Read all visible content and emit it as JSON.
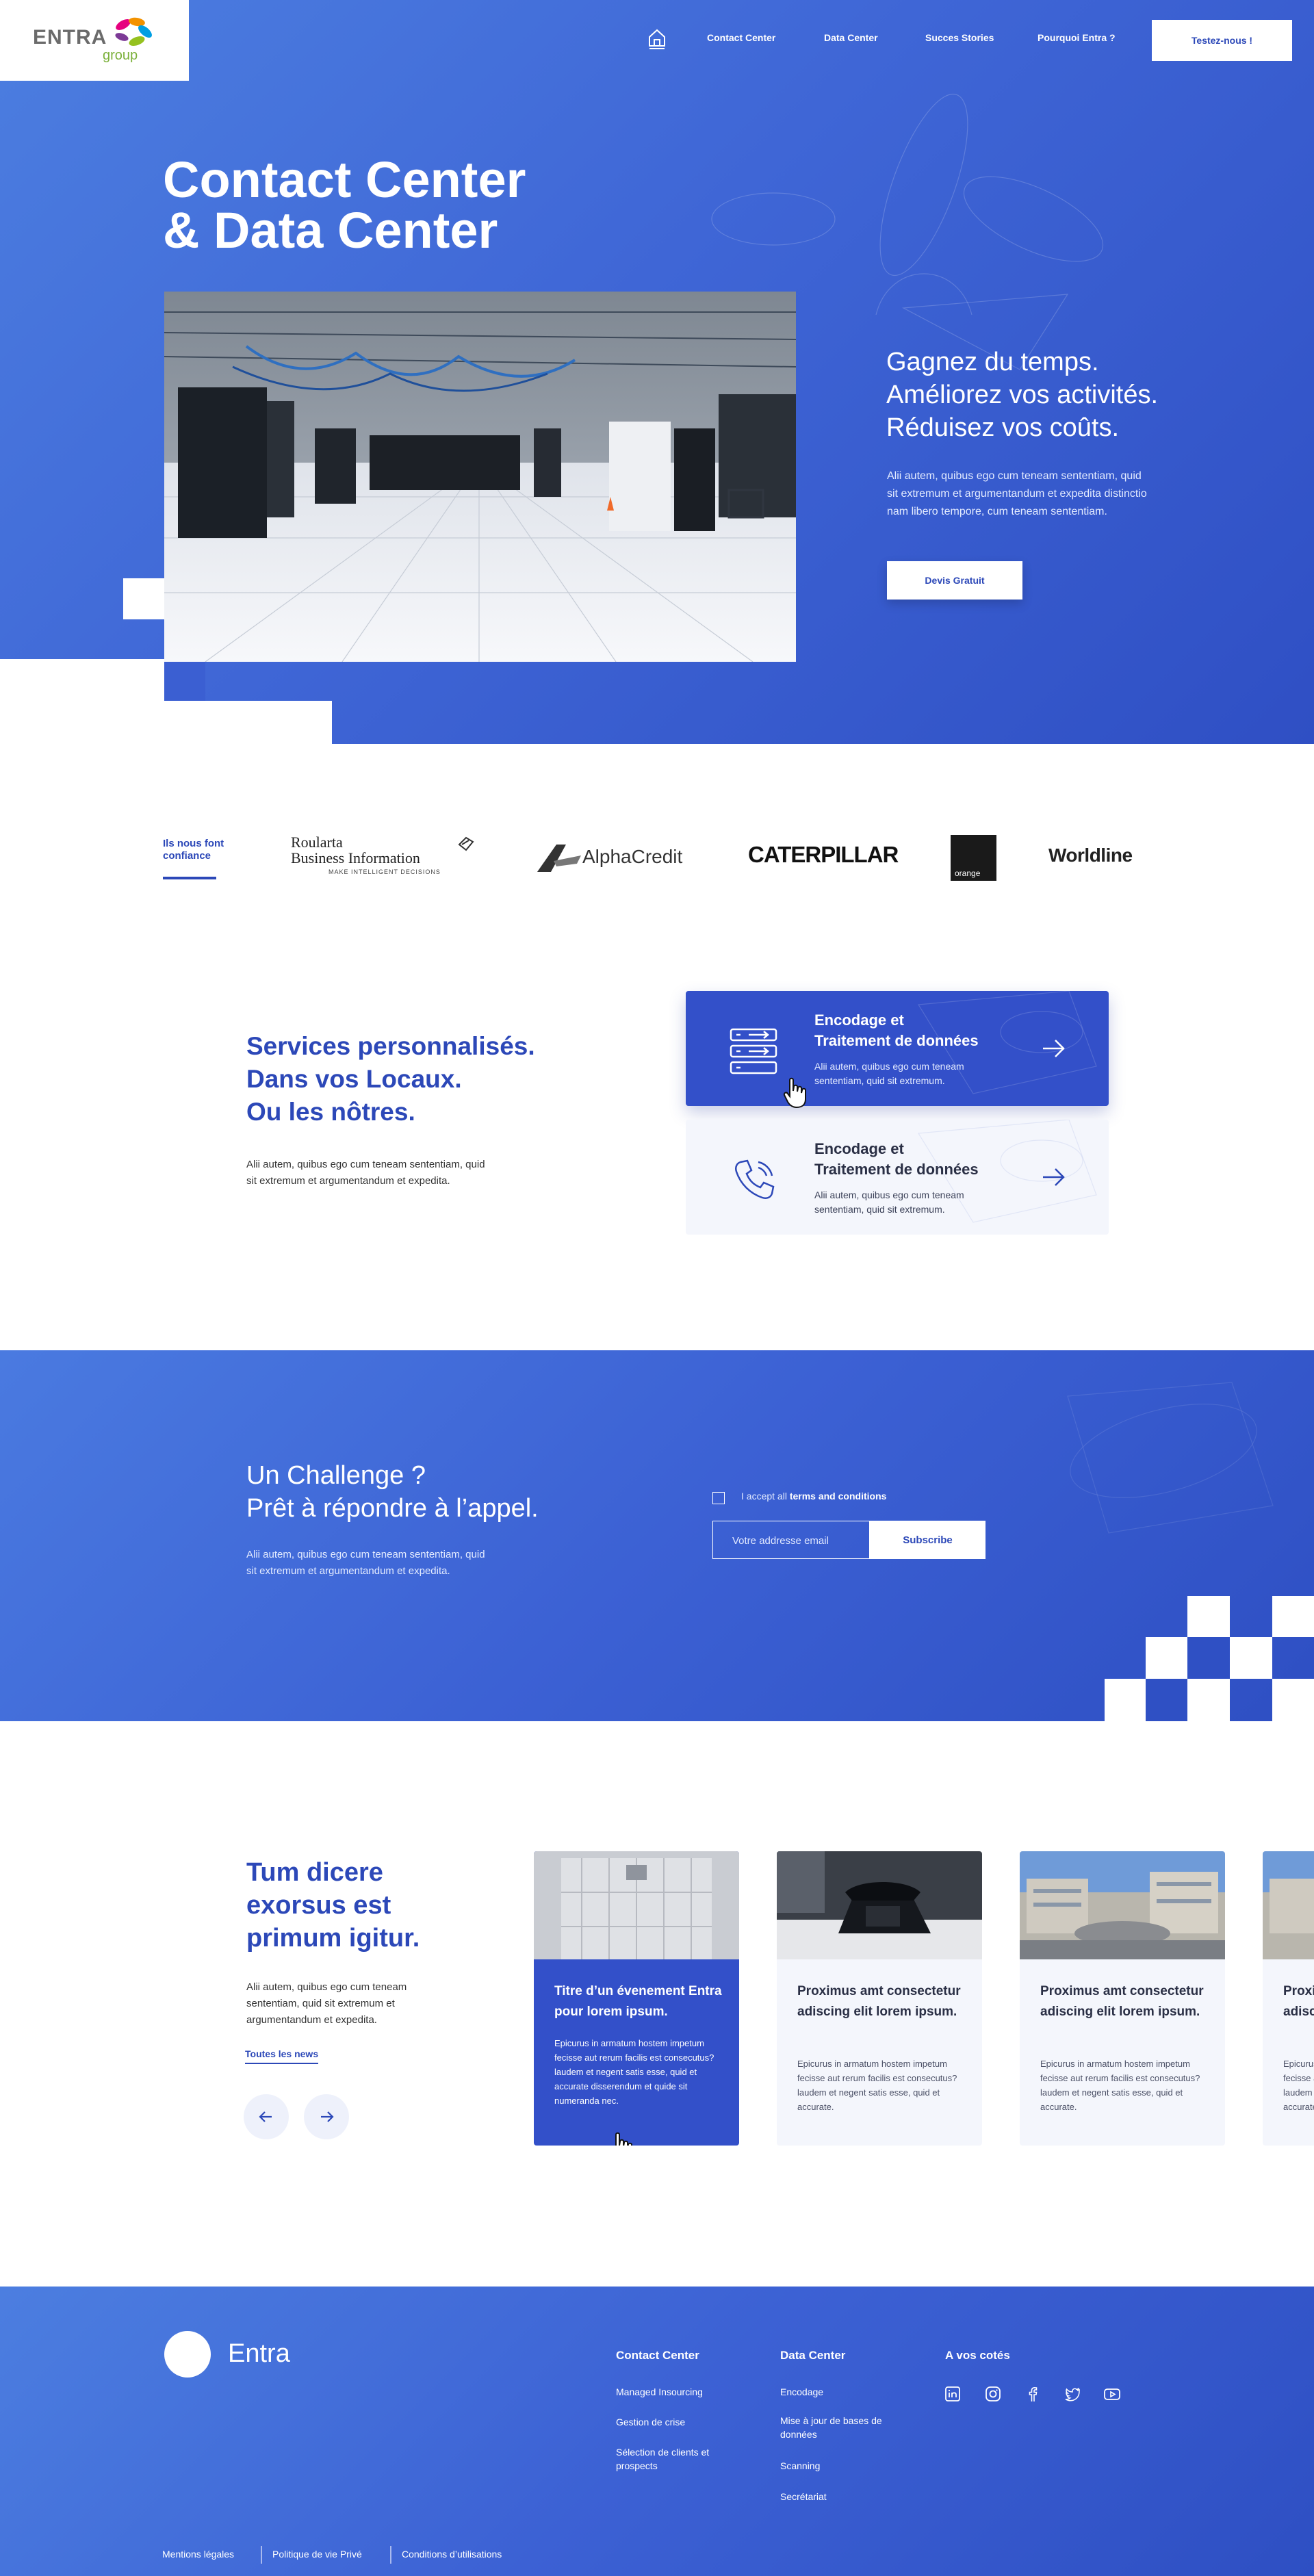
{
  "brand": {
    "name": "ENTRA",
    "sub": "group",
    "footer_name": "Entra"
  },
  "nav": {
    "items": [
      "Contact Center",
      "Data Center",
      "Succes Stories",
      "Pourquoi Entra ?"
    ],
    "cta": "Testez-nous !"
  },
  "hero": {
    "title_1": "Contact Center",
    "title_2": "& Data Center",
    "tagline_1": "Gagnez du temps.",
    "tagline_2": "Améliorez vos activités.",
    "tagline_3": "Réduisez vos coûts.",
    "text": "Alii autem, quibus ego cum teneam sententiam, quid sit extremum et argumentandum et expedita distinctio nam libero tempore, cum teneam sententiam.",
    "cta": "Devis Gratuit"
  },
  "clients": {
    "label_1": "Ils nous font",
    "label_2": "confiance",
    "logos": {
      "roularta_1": "Roularta",
      "roularta_2": "Business Information",
      "roularta_3": "MAKE INTELLIGENT DECISIONS",
      "alpha": "AlphaCredit",
      "cat": "CATERPILLAR",
      "orange": "orange",
      "worldline": "Worldline"
    }
  },
  "services": {
    "title_1": "Services personnalisés.",
    "title_2": "Dans vos Locaux.",
    "title_3": "Ou les nôtres.",
    "text": "Alii autem, quibus ego cum teneam sententiam, quid sit extremum et argumentandum et expedita.",
    "cards": [
      {
        "title_1": "Encodage et",
        "title_2": "Traitement de données",
        "text": "Alii autem, quibus ego cum teneam sententiam, quid sit extremum."
      },
      {
        "title_1": "Encodage et",
        "title_2": "Traitement de données",
        "text": "Alii autem, quibus ego cum teneam sententiam, quid sit extremum."
      }
    ]
  },
  "challenge": {
    "title_1": "Un Challenge ?",
    "title_2": "Prêt à répondre à l’appel.",
    "text": "Alii autem, quibus ego cum teneam sententiam, quid sit extremum et argumentandum et expedita.",
    "terms_prefix": "I accept all ",
    "terms_link": "terms and conditions",
    "email_placeholder": "Votre addresse email",
    "subscribe": "Subscribe"
  },
  "news": {
    "title_1": "Tum dicere",
    "title_2": "exorsus est",
    "title_3": "primum igitur.",
    "text": "Alii autem, quibus ego cum teneam sententiam, quid sit extremum et argumentandum et expedita.",
    "link": "Toutes les news",
    "cards": [
      {
        "title": "Titre d’un évenement Entra pour lorem ipsum.",
        "text": "Epicurus in armatum hostem impetum fecisse aut rerum facilis est consecutus? laudem et negent satis esse, quid et accurate disserendum et quide sit numeranda nec."
      },
      {
        "title": "Proximus amt consectetur adiscing elit lorem ipsum.",
        "text": "Epicurus in armatum hostem impetum fecisse aut rerum facilis est consecutus? laudem et negent satis esse, quid et accurate."
      },
      {
        "title": "Proximus amt consectetur adiscing elit lorem ipsum.",
        "text": "Epicurus in armatum hostem impetum fecisse aut rerum facilis est consecutus? laudem et negent satis esse, quid et accurate."
      },
      {
        "title": "Proximus amt consectetur adiscing elit lorem ipsum.",
        "text": "Epicurus in armatum hostem impetum fecisse aut rerum facilis est consecutus? laudem et negent satis esse, quid et accurate."
      }
    ]
  },
  "footer": {
    "col1": {
      "heading": "Contact Center",
      "links": [
        "Managed Insourcing",
        "Gestion de crise",
        "Sélection de clients et prospects"
      ]
    },
    "col2": {
      "heading": "Data Center",
      "links": [
        "Encodage",
        "Mise à jour de bases de données",
        "Scanning",
        "Secrétariat"
      ]
    },
    "col3": {
      "heading": "A vos cotés"
    },
    "legal": [
      "Mentions légales",
      "Politique de vie Privé",
      "Conditions d’utilisations"
    ]
  },
  "colors": {
    "primary": "#2c48b8",
    "accent": "#3350c9",
    "card_light": "#f4f6fc"
  }
}
